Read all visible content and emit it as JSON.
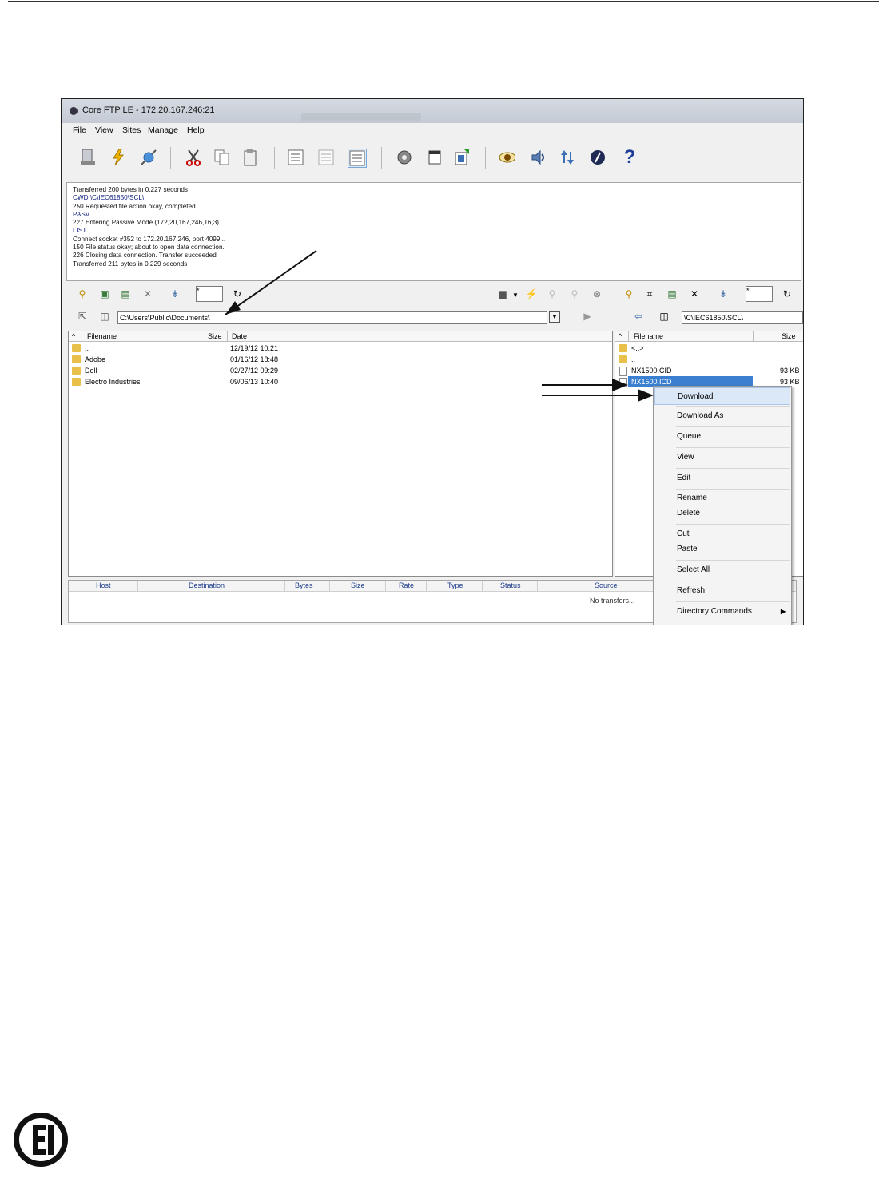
{
  "window": {
    "title": "Core FTP LE - 172.20.167.246:21"
  },
  "menu": [
    "File",
    "View",
    "Sites",
    "Manage",
    "Help"
  ],
  "log": {
    "lines": [
      {
        "text": "Transferred 200 bytes in 0.227 seconds",
        "color": "black"
      },
      {
        "text": "CWD \\C\\IEC61850\\SCL\\",
        "color": "blue"
      },
      {
        "text": "250 Requested file action okay, completed.",
        "color": "black"
      },
      {
        "text": "PASV",
        "color": "blue"
      },
      {
        "text": "227 Entering Passive Mode (172,20,167,246,16,3)",
        "color": "black"
      },
      {
        "text": "LIST",
        "color": "blue"
      },
      {
        "text": "Connect socket #352 to 172.20.167.246, port 4099...",
        "color": "black"
      },
      {
        "text": "150 File status okay; about to open data connection.",
        "color": "black"
      },
      {
        "text": "226 Closing data connection. Transfer succeeded",
        "color": "black"
      },
      {
        "text": "Transferred 211 bytes in 0.229 seconds",
        "color": "black"
      }
    ]
  },
  "local": {
    "filter": "*",
    "path": "C:\\Users\\Public\\Documents\\",
    "columns": {
      "filename": "Filename",
      "size": "Size",
      "date": "Date"
    },
    "rows": [
      {
        "name": "..",
        "size": "",
        "date": "12/19/12  10:21"
      },
      {
        "name": "Adobe",
        "size": "",
        "date": "01/16/12  18:48"
      },
      {
        "name": "Dell",
        "size": "",
        "date": "02/27/12  09:29"
      },
      {
        "name": "Electro Industries",
        "size": "",
        "date": "09/06/13  10:40"
      }
    ]
  },
  "remote": {
    "filter": "*",
    "path": "\\C\\IEC61850\\SCL\\",
    "columns": {
      "filename": "Filename",
      "size": "Size"
    },
    "rows": [
      {
        "name": "<..>",
        "size": "",
        "type": "folder"
      },
      {
        "name": "..",
        "size": "",
        "type": "folder"
      },
      {
        "name": "NX1500.CID",
        "size": "93 KB",
        "type": "file"
      },
      {
        "name": "NX1500.ICD",
        "size": "93 KB",
        "type": "file",
        "selected": true
      }
    ]
  },
  "context_menu": {
    "items": [
      "Download",
      "Download As",
      "Queue",
      "View",
      "Edit",
      "Rename",
      "Delete",
      "Cut",
      "Paste",
      "Select All",
      "Refresh",
      "Directory Commands"
    ],
    "highlighted": "Download"
  },
  "queue": {
    "columns": [
      "Host",
      "Destination",
      "Bytes",
      "Size",
      "Rate",
      "Type",
      "Status",
      "Source"
    ],
    "empty_text": "No transfers..."
  },
  "colors": {
    "selection": "#3b7fd0",
    "menu_highlight": "#dbe8f8",
    "folder": "#e8c04a"
  },
  "footer": {
    "logo": "EIG",
    "logo_color": "#111111"
  }
}
